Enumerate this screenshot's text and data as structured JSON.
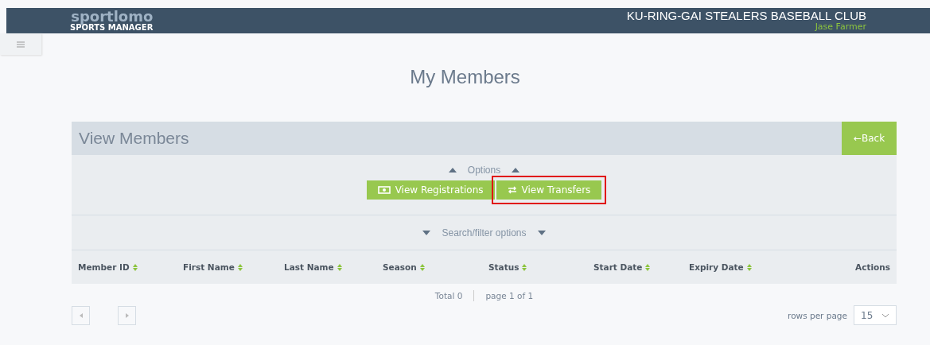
{
  "header": {
    "logo": "sportlomo",
    "logo_subtitle": "SPORTS MANAGER",
    "club": "KU-RING-GAI STEALERS BASEBALL CLUB",
    "user": "Jase Farmer"
  },
  "page_title": "My Members",
  "panel": {
    "title": "View Members",
    "back": "←Back",
    "options_label": "Options",
    "options_expanded": true,
    "actions": [
      {
        "label": "View Registrations",
        "kind": "registrations",
        "highlighted": false
      },
      {
        "label": "View Transfers",
        "kind": "transfers",
        "highlighted": true
      }
    ],
    "filter_label": "Search/filter options",
    "filter_expanded": false
  },
  "table": {
    "columns": [
      {
        "label": "Member ID",
        "sortable": true
      },
      {
        "label": "First Name",
        "sortable": true
      },
      {
        "label": "Last Name",
        "sortable": true
      },
      {
        "label": "Season",
        "sortable": true
      },
      {
        "label": "Status",
        "sortable": true
      },
      {
        "label": "Start Date",
        "sortable": true
      },
      {
        "label": "Expiry Date",
        "sortable": true
      },
      {
        "label": "Actions",
        "sortable": false
      }
    ]
  },
  "footer": {
    "total": "Total 0",
    "page": "page 1 of 1",
    "rows_label": "rows per page",
    "rows_value": "15"
  }
}
